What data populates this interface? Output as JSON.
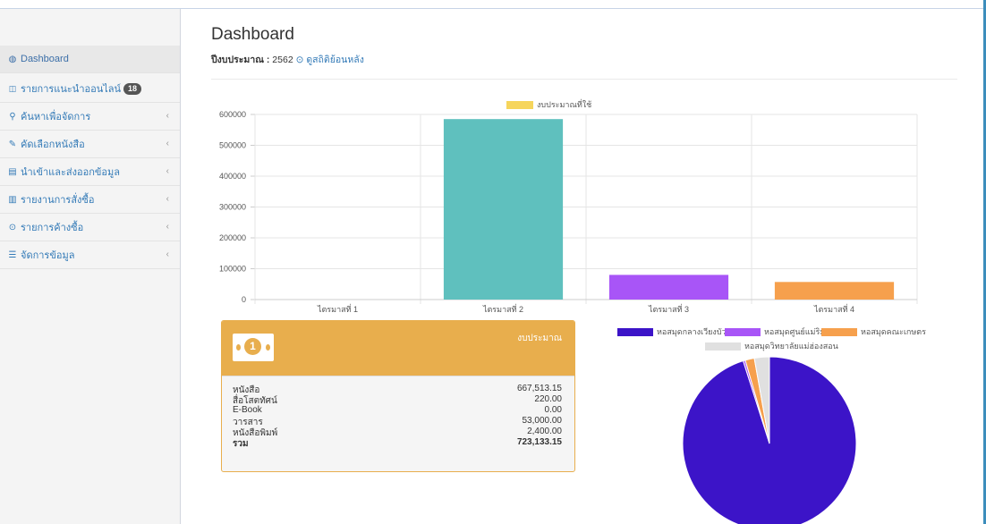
{
  "sidebar": {
    "items": [
      {
        "icon": "dashboard-icon",
        "glyph": "◍",
        "label": "Dashboard",
        "active": true
      },
      {
        "icon": "cart-icon",
        "glyph": "🛒",
        "label": "รายการแนะนำออนไลน์",
        "badge": "18"
      },
      {
        "icon": "search-icon",
        "glyph": "🔍",
        "label": "ค้นหาเพื่อจัดการ",
        "chevron": "‹"
      },
      {
        "icon": "edit-icon",
        "glyph": "✎",
        "label": "คัดเลือกหนังสือ",
        "chevron": "‹"
      },
      {
        "icon": "database-icon",
        "glyph": "▤",
        "label": "นำเข้าและส่งออกข้อมูล",
        "chevron": "‹"
      },
      {
        "icon": "bar-chart-icon",
        "glyph": "▥",
        "label": "รายงานการสั่งซื้อ",
        "chevron": "‹"
      },
      {
        "icon": "clock-icon",
        "glyph": "⊙",
        "label": "รายการค้างซื้อ",
        "chevron": "‹"
      },
      {
        "icon": "sliders-icon",
        "glyph": "☰",
        "label": "จัดการข้อมูล",
        "chevron": "‹"
      }
    ]
  },
  "header": {
    "title": "Dashboard",
    "budget_year_label": "ปีงบประมาณ :",
    "budget_year_value": "2562",
    "history_link": "ดูสถิติย้อนหลัง"
  },
  "chart_data": [
    {
      "type": "bar",
      "categories": [
        "ไตรมาสที่ 1",
        "ไตรมาสที่ 2",
        "ไตรมาสที่ 3",
        "ไตรมาสที่ 4"
      ],
      "series": [
        {
          "name": "งบประมาณที่ใช้",
          "values": [
            0,
            585000,
            80000,
            57000
          ]
        }
      ],
      "bar_colors": [
        "#5fc0be",
        "#5fc0be",
        "#a855f7",
        "#f6a04d"
      ],
      "legend_color": "#f6d55c",
      "ylim": [
        0,
        600000
      ],
      "yticks": [
        "0",
        "100000",
        "200000",
        "300000",
        "400000",
        "500000",
        "600000"
      ],
      "ytick_values": [
        0,
        100000,
        200000,
        300000,
        400000,
        500000,
        600000
      ],
      "grid": true,
      "legend": "top"
    },
    {
      "type": "pie",
      "labels": [
        "หอสมุดกลางเวียงบัว",
        "หอสมุดศูนย์แม่ริม",
        "หอสมุดคณะเกษตร",
        "หอสมุดวิทยาลัยแม่ฮ่องสอน"
      ],
      "values": [
        95.1,
        0.4,
        1.7,
        2.8
      ],
      "colors": [
        "#3c14c8",
        "#a855f7",
        "#f6a04d",
        "#e0e0e0"
      ],
      "legend": "top"
    }
  ],
  "budget_card": {
    "title": "งบประมาณ",
    "icon": "money-icon",
    "coin_glyph": "1",
    "rows": [
      {
        "label": "หนังสือ",
        "value": "667,513.15"
      },
      {
        "label": "สื่อโสตทัศน์",
        "value": "220.00"
      },
      {
        "label": "E-Book",
        "value": "0.00"
      },
      {
        "label": "วารสาร",
        "value": "53,000.00"
      },
      {
        "label": "หนังสือพิมพ์",
        "value": "2,400.00"
      }
    ],
    "total_label": "รวม",
    "total_value": "723,133.15"
  },
  "colors": {
    "accent": "#337ab7",
    "card": "#e8ae4d"
  }
}
